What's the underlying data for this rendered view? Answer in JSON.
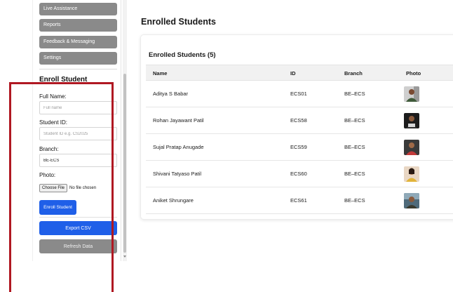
{
  "sidebar": {
    "nav_items": [
      "Live Assistance",
      "Reports",
      "Feedback & Messaging",
      "Settings"
    ],
    "enroll_heading": "Enroll Student",
    "form": {
      "full_name_label": "Full Name:",
      "full_name_placeholder": "Full name",
      "student_id_label": "Student ID:",
      "student_id_placeholder": "Student ID e.g. CS2025",
      "branch_label": "Branch:",
      "branch_value": "BE-ECS",
      "photo_label": "Photo:",
      "choose_file_label": "Choose File",
      "no_file_text": "No file chosen",
      "enroll_button": "Enroll Student"
    },
    "export_button": "Export CSV",
    "refresh_button": "Refresh Data"
  },
  "main": {
    "page_title": "Enrolled Students",
    "card_title": "Enrolled Students (5)",
    "table": {
      "headers": [
        "Name",
        "ID",
        "Branch",
        "Photo"
      ],
      "rows": [
        {
          "name": "Aditya S Babar",
          "id": "ECS01",
          "branch": "BE–ECS"
        },
        {
          "name": "Rohan Jayawant Patil",
          "id": "ECS58",
          "branch": "BE–ECS"
        },
        {
          "name": "Sujal Pratap Anugade",
          "id": "ECS59",
          "branch": "BE–ECS"
        },
        {
          "name": "Shivani Tatyaso Patil",
          "id": "ECS60",
          "branch": "BE–ECS"
        },
        {
          "name": "Aniket Shrungare",
          "id": "ECS61",
          "branch": "BE–ECS"
        }
      ]
    }
  },
  "colors": {
    "primary_button": "#1f5fe8",
    "sidebar_button": "#8a8a8a",
    "highlight_border": "#b01822"
  }
}
